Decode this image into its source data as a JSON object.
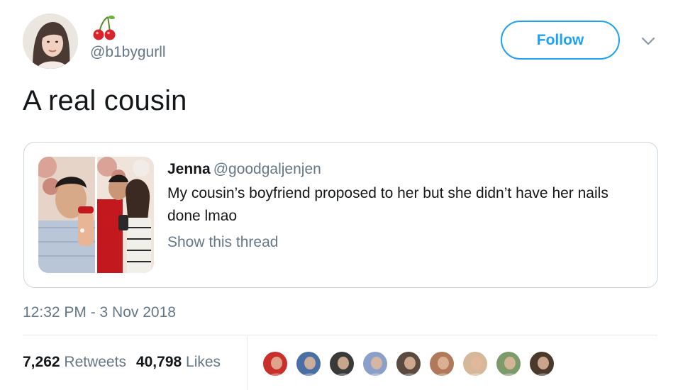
{
  "author": {
    "handle": "@b1bygurll",
    "avatar": "profile-photo",
    "display_name_icon": "cherries-emoji"
  },
  "follow_label": "Follow",
  "menu_icon": "chevron-down-icon",
  "tweet": {
    "text": "A real cousin",
    "timestamp": "12:32 PM - 3 Nov 2018"
  },
  "quoted_tweet": {
    "name": "Jenna",
    "handle": "@goodgaljenjen",
    "text": "My cousin’s boyfriend proposed to her but she didn’t have her nails done lmao",
    "show_thread": "Show this thread",
    "media": [
      "proposal-photo-1",
      "proposal-photo-2"
    ]
  },
  "stats": {
    "retweets_count": "7,262",
    "retweets_label": "Retweets",
    "likes_count": "40,798",
    "likes_label": "Likes"
  },
  "likers": [
    {
      "name": "liker-avatar-1",
      "color": "#c9302c"
    },
    {
      "name": "liker-avatar-2",
      "color": "#4a6fa5"
    },
    {
      "name": "liker-avatar-3",
      "color": "#3a3a3a"
    },
    {
      "name": "liker-avatar-4",
      "color": "#8aa0c8"
    },
    {
      "name": "liker-avatar-5",
      "color": "#5b4a3f"
    },
    {
      "name": "liker-avatar-6",
      "color": "#b07a5a"
    },
    {
      "name": "liker-avatar-7",
      "color": "#d7b79a"
    },
    {
      "name": "liker-avatar-8",
      "color": "#7d9a6a"
    },
    {
      "name": "liker-avatar-9",
      "color": "#4b3a2c"
    }
  ],
  "colors": {
    "accent": "#1da1f2",
    "text_primary": "#14171a",
    "text_secondary": "#657786",
    "border": "#ccd6dd"
  }
}
